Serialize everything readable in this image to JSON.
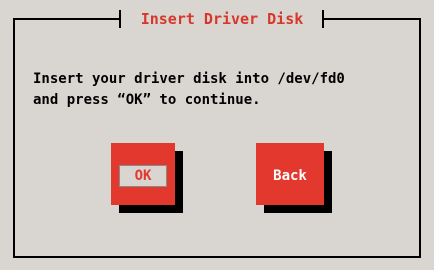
{
  "dialog": {
    "title": "Insert Driver Disk",
    "message_line1": "Insert your driver disk into /dev/fd0",
    "message_line2": "and press “OK” to continue.",
    "buttons": {
      "ok_label": "OK",
      "back_label": "Back"
    },
    "focused_button": "OK"
  },
  "colors": {
    "dialog_background": "#d9d6d1",
    "button_red": "#e3382d",
    "title_red": "#d9362b",
    "frame_black": "#000000"
  }
}
